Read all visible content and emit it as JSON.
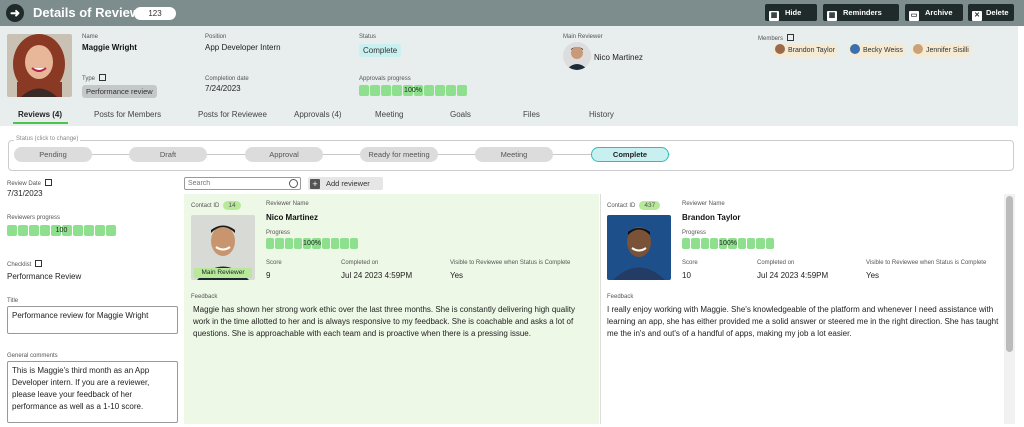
{
  "header": {
    "title": "Details of Review",
    "id": "123",
    "buttons": {
      "hide": "Hide",
      "reminders": "Reminders",
      "archive": "Archive",
      "delete": "Delete"
    }
  },
  "review": {
    "name_label": "Name",
    "name": "Maggie Wright",
    "position_label": "Position",
    "position": "App Developer Intern",
    "status_label": "Status",
    "status": "Complete",
    "main_reviewer_label": "Main Reviewer",
    "main_reviewer": "Nico Martinez",
    "members_label": "Members",
    "members": [
      "Brandon Taylor",
      "Becky Weiss",
      "Jennifer Sisilli"
    ],
    "type_label": "Type",
    "type": "Performance review",
    "completion_label": "Completion date",
    "completion_date": "7/24/2023",
    "approvals_label": "Approvals progress",
    "approvals_progress": "100%",
    "approvals_progress_value": 1.0
  },
  "tabs": [
    "Reviews (4)",
    "Posts for Members",
    "Posts for Reviewee",
    "Approvals (4)",
    "Meeting",
    "Goals",
    "Files",
    "History"
  ],
  "stepper": {
    "caption": "Status (click to change)",
    "steps": [
      "Pending",
      "Draft",
      "Approval",
      "Ready for meeting",
      "Meeting",
      "Complete"
    ],
    "current": "Complete"
  },
  "left": {
    "review_date_label": "Review Date",
    "review_date": "7/31/2023",
    "reviewers_progress_label": "Reviewers progress",
    "reviewers_progress": "100",
    "reviewers_progress_value": 1.0,
    "checklist_label": "Checklist",
    "checklist": "Performance Review",
    "title_label": "Title",
    "title": "Performance review for Maggie Wright",
    "comments_label": "General comments",
    "comments": "This is Maggie's third month as an App Developer intern. If you are a reviewer, please leave your feedback of her performance as well as a 1-10 score."
  },
  "search": {
    "placeholder": "Search"
  },
  "add_reviewer": "Add reviewer",
  "cards": [
    {
      "contact_label": "Contact ID",
      "contact_id": "14",
      "reviewer_label": "Reviewer Name",
      "reviewer": "Nico Martinez",
      "progress_label": "Progress",
      "progress": "100%",
      "score_label": "Score",
      "score": "9",
      "completed_label": "Completed on",
      "completed": "Jul 24 2023 4:59PM",
      "visible_label": "Visible to Reviewee when Status is Complete",
      "visible": "Yes",
      "badge": "Main Reviewer",
      "feedback_label": "Feedback",
      "feedback": "Maggie has shown her strong work ethic over the last three months. She is constantly delivering high quality work in the time allotted to her and is always responsive to my feedback. She is coachable and asks a lot of questions. She is approachable with each team and is proactive when there is a pressing issue."
    },
    {
      "contact_label": "Contact ID",
      "contact_id": "437",
      "reviewer_label": "Reviewer Name",
      "reviewer": "Brandon Taylor",
      "progress_label": "Progress",
      "progress": "100%",
      "score_label": "Score",
      "score": "10",
      "completed_label": "Completed on",
      "completed": "Jul 24 2023 4:59PM",
      "visible_label": "Visible to Reviewee when Status is Complete",
      "visible": "Yes",
      "feedback_label": "Feedback",
      "feedback": "I really enjoy working with Maggie. She's knowledgeable of the platform and whenever I need assistance with learning an app, she has either provided me a solid answer or steered me in the right direction. She has taught me the in's and out's of a handful of apps, making my job a lot easier."
    }
  ],
  "colors": {
    "titlebar": "#7d8c8c",
    "header_bg": "#e8eded",
    "progress": "#8ee08e",
    "card_main_bg": "#eef8e6",
    "tab_accent": "#4cc44c"
  }
}
